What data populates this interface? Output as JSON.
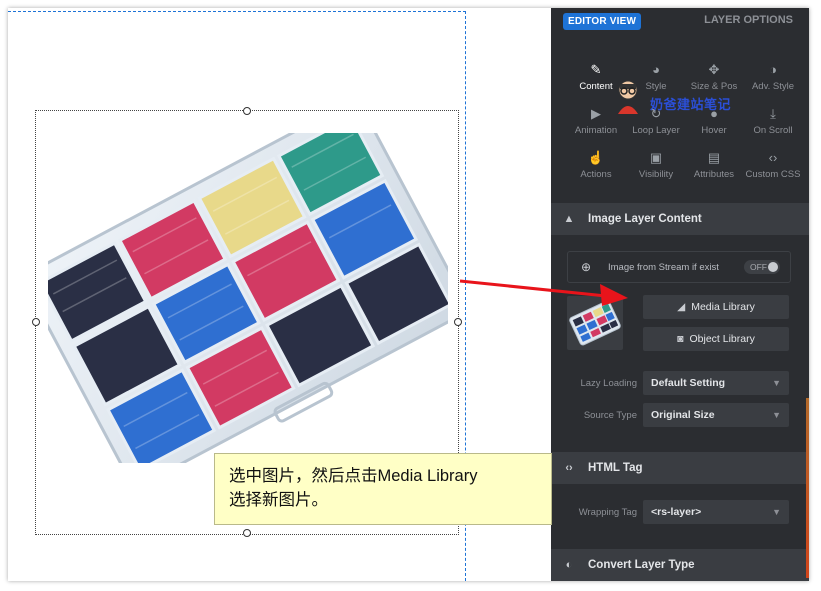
{
  "panel": {
    "editor_view": "EDITOR VIEW",
    "layer_options": "LAYER OPTIONS",
    "tabs": [
      {
        "label": "Content",
        "icon": "pencil-icon"
      },
      {
        "label": "Style",
        "icon": "palette-icon"
      },
      {
        "label": "Size & Pos",
        "icon": "move-arrows-icon"
      },
      {
        "label": "Adv. Style",
        "icon": "contrast-icon"
      },
      {
        "label": "Animation",
        "icon": "play-icon"
      },
      {
        "label": "Loop Layer",
        "icon": "loop-icon"
      },
      {
        "label": "Hover",
        "icon": "hover-pointer-icon"
      },
      {
        "label": "On Scroll",
        "icon": "scroll-icon"
      },
      {
        "label": "Actions",
        "icon": "hand-pointer-icon"
      },
      {
        "label": "Visibility",
        "icon": "visibility-icon"
      },
      {
        "label": "Attributes",
        "icon": "document-icon"
      },
      {
        "label": "Custom CSS",
        "icon": "code-icon"
      }
    ],
    "image_section": {
      "title": "Image Layer Content",
      "stream_label": "Image from Stream if exist",
      "stream_toggle": "OFF",
      "media_library": "Media Library",
      "object_library": "Object Library",
      "lazy_loading_label": "Lazy Loading",
      "lazy_loading_value": "Default Setting",
      "source_type_label": "Source Type",
      "source_type_value": "Original Size"
    },
    "html_section": {
      "title": "HTML Tag",
      "wrapping_tag_label": "Wrapping Tag",
      "wrapping_tag_value": "<rs-layer>"
    },
    "convert_section": {
      "title": "Convert Layer Type"
    }
  },
  "watermark": "奶爸建站笔记",
  "annotation": {
    "line1": "选中图片，然后点击Media Library",
    "line2": "选择新图片。"
  },
  "colors": {
    "accent": "#1e73d6",
    "panel_bg": "#2b2d31",
    "section_bg": "#3a3d42",
    "note_bg": "#ffffc6",
    "arrow": "#e8141b"
  }
}
